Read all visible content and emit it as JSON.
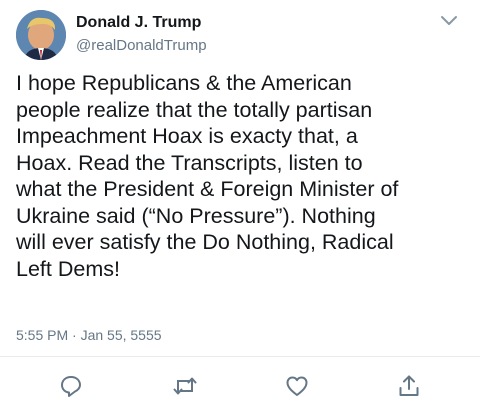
{
  "tweet": {
    "author_name": "Donald J. Trump",
    "author_handle": "@realDonaldTrump",
    "text": "I hope Republicans & the American\npeople realize that the totally partisan\nImpeachment Hoax is exacty that, a\nHoax. Read the Transcripts, listen to\nwhat the President & Foreign Minister of\nUkraine said (“No Pressure”). Nothing\nwill ever satisfy the Do Nothing, Radical\nLeft Dems!",
    "timestamp": "5:55 PM · Jan 55, 5555"
  },
  "icons": {
    "menu": "chevron-down-icon",
    "reply": "reply-icon",
    "retweet": "retweet-icon",
    "like": "like-icon",
    "share": "share-icon"
  },
  "colors": {
    "primary_text": "#14171a",
    "secondary_text": "#657786",
    "icon": "#657786",
    "divider": "#e6ecf0"
  }
}
